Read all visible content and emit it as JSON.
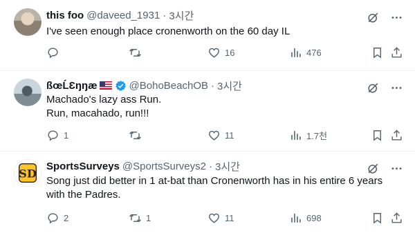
{
  "tweets": [
    {
      "name": "this foo",
      "handle": "@daveed_1931",
      "separator": "·",
      "time": "3시간",
      "lines": [
        "I've seen enough place cronenworth on the 60 day IL"
      ],
      "replies": "",
      "retweets": "",
      "likes": "16",
      "views": "476",
      "verified": false,
      "flag": false
    },
    {
      "name": "ßœĹƐŋŋæ",
      "handle": "@BohoBeachOB",
      "separator": "·",
      "time": "3시간",
      "lines": [
        "Machado's lazy ass Run.",
        "Run, macahado, run!!!"
      ],
      "replies": "1",
      "retweets": "",
      "likes": "11",
      "views": "1.7천",
      "verified": true,
      "flag": true
    },
    {
      "name": "SportsSurveys",
      "handle": "@SportsSurveys2",
      "separator": "·",
      "time": "3시간",
      "lines": [
        "Song just did better in 1 at-bat than Cronenworth has in his entire 6 years",
        "with the Padres."
      ],
      "replies": "2",
      "retweets": "1",
      "likes": "11",
      "views": "698",
      "verified": false,
      "flag": false
    }
  ],
  "icons": {
    "grok": "grok-icon",
    "more": "more-icon",
    "reply": "reply-icon",
    "retweet": "retweet-icon",
    "like": "like-icon",
    "views": "views-icon",
    "bookmark": "bookmark-icon",
    "share": "share-icon",
    "verified": "verified-badge-icon",
    "flag": "us-flag-emoji"
  },
  "colors": {
    "text": "#0f1419",
    "secondary": "#536471",
    "verified": "#1d9bf0",
    "divider": "#eff3f4",
    "padres_gold": "#ffc425",
    "padres_brown": "#2f241d"
  }
}
